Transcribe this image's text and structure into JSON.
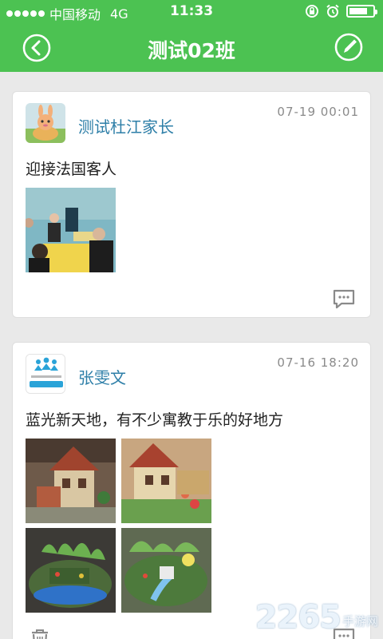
{
  "status_bar": {
    "carrier": "中国移动",
    "network": "4G",
    "time": "11:33"
  },
  "nav": {
    "title": "测试02班",
    "back_icon": "back-circle-icon",
    "edit_icon": "edit-circle-icon"
  },
  "posts": [
    {
      "author": "测试杜江家长",
      "time": "07-19 00:01",
      "content": "迎接法国客人",
      "photo_count": 1
    },
    {
      "author": "张雯文",
      "time": "07-16 18:20",
      "content": "蓝光新天地，有不少寓教于乐的好地方",
      "photo_count": 4
    }
  ],
  "watermark": {
    "number": "2265",
    "site": "手游网"
  },
  "colors": {
    "header_green": "#4cc252",
    "author_blue": "#2e7fa8",
    "background": "#e9e9e9"
  }
}
